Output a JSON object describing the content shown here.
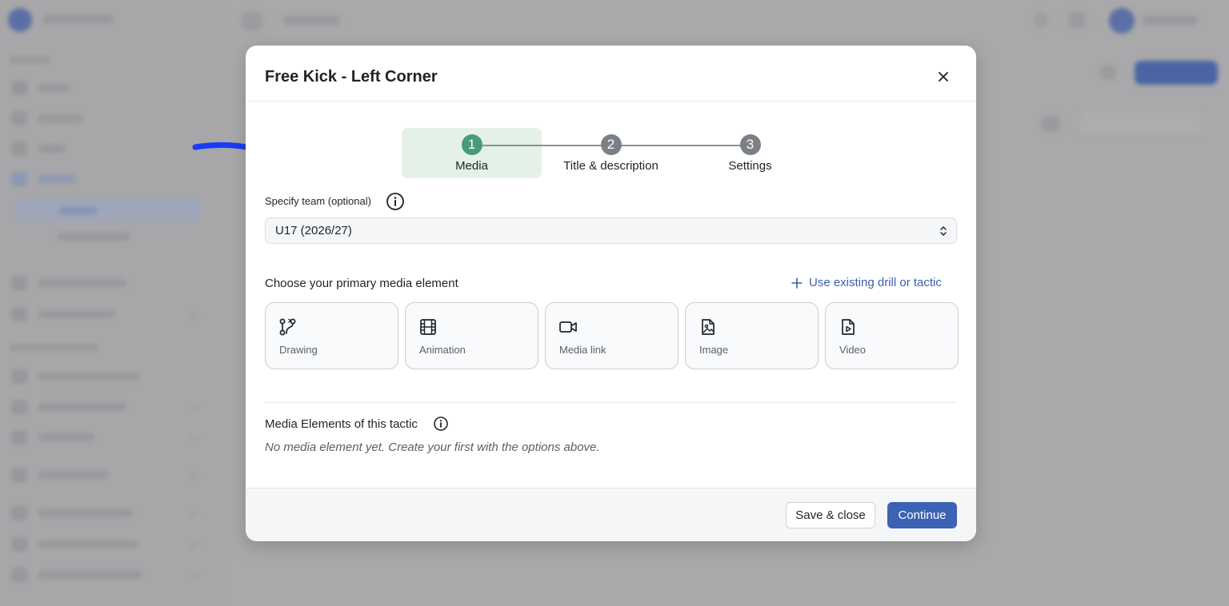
{
  "modal": {
    "title": "Free Kick - Left Corner",
    "steps": [
      {
        "number": "1",
        "label": "Media",
        "active": true
      },
      {
        "number": "2",
        "label": "Title & description",
        "active": false
      },
      {
        "number": "3",
        "label": "Settings",
        "active": false
      }
    ],
    "team": {
      "label": "Specify team (optional)",
      "selected": "U17 (2026/27)"
    },
    "media": {
      "label": "Choose your primary media element",
      "use_existing": "Use existing drill or tactic",
      "options": [
        {
          "label": "Drawing",
          "icon": "drawing-icon"
        },
        {
          "label": "Animation",
          "icon": "film-icon"
        },
        {
          "label": "Media link",
          "icon": "video-camera-icon"
        },
        {
          "label": "Image",
          "icon": "image-file-icon"
        },
        {
          "label": "Video",
          "icon": "video-file-icon"
        }
      ]
    },
    "elements": {
      "label": "Media Elements of this tactic",
      "empty_text": "No media element yet. Create your first with the options above."
    },
    "footer": {
      "save_label": "Save & close",
      "continue_label": "Continue"
    }
  },
  "colors": {
    "accent": "#3c62b4",
    "step_active": "#4b9a7c",
    "step_active_bg": "#e4f1e6",
    "annotation_arrow": "#1b3cf5"
  }
}
